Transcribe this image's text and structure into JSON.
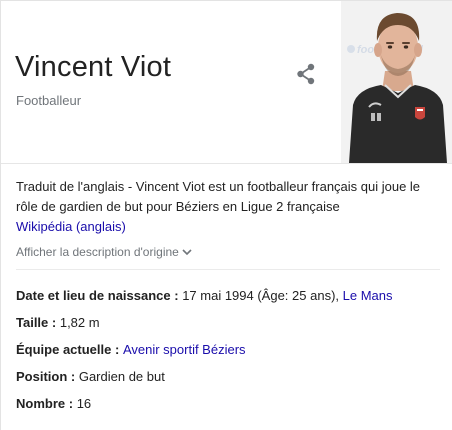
{
  "header": {
    "name": "Vincent Viot",
    "subtitle": "Footballeur",
    "share_icon": "share-icon",
    "photo_watermark": "foot national"
  },
  "description": {
    "text": "Traduit de l'anglais - Vincent Viot est un footballeur français qui joue le rôle de gardien de but pour Béziers en Ligue 2 française",
    "source_link": "Wikipédia (anglais)",
    "show_original": "Afficher la description d'origine"
  },
  "facts": {
    "birth": {
      "label": "Date et lieu de naissance",
      "value": "17 mai 1994 (Âge: 25 ans),",
      "link": "Le Mans"
    },
    "height": {
      "label": "Taille",
      "value": "1,82 m"
    },
    "team": {
      "label": "Équipe actuelle",
      "link": "Avenir sportif Béziers"
    },
    "position": {
      "label": "Position",
      "value": "Gardien de but"
    },
    "number": {
      "label": "Nombre",
      "value": "16"
    }
  },
  "colors": {
    "link": "#1a0dab",
    "text": "#222222",
    "muted": "#70757a"
  }
}
